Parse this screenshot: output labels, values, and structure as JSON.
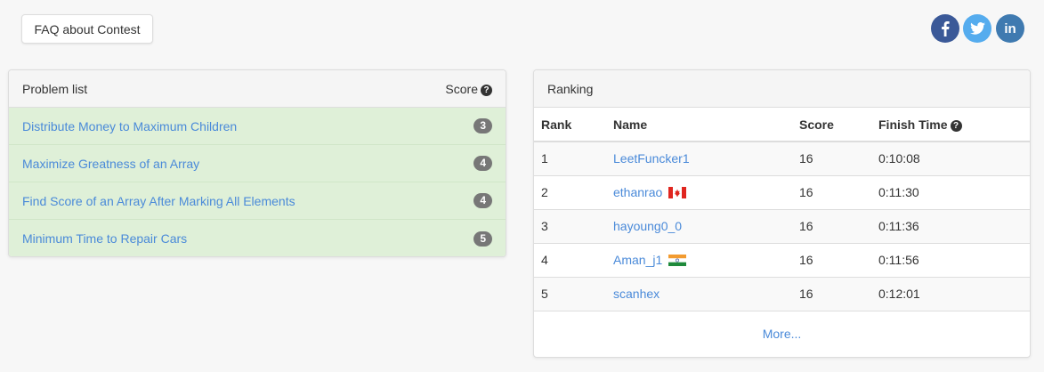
{
  "faq_button": "FAQ about Contest",
  "social": [
    {
      "name": "facebook",
      "glyph": "f",
      "color": "#3b5998"
    },
    {
      "name": "twitter",
      "glyph": "t",
      "color": "#55acee"
    },
    {
      "name": "linkedin",
      "glyph": "in",
      "color": "#3f7ab0"
    }
  ],
  "problems": {
    "title": "Problem list",
    "score_label": "Score",
    "items": [
      {
        "name": "Distribute Money to Maximum Children",
        "score": "3"
      },
      {
        "name": "Maximize Greatness of an Array",
        "score": "4"
      },
      {
        "name": "Find Score of an Array After Marking All Elements",
        "score": "4"
      },
      {
        "name": "Minimum Time to Repair Cars",
        "score": "5"
      }
    ]
  },
  "ranking": {
    "title": "Ranking",
    "columns": {
      "rank": "Rank",
      "name": "Name",
      "score": "Score",
      "finish": "Finish Time"
    },
    "rows": [
      {
        "rank": "1",
        "name": "LeetFuncker1",
        "score": "16",
        "finish": "0:10:08",
        "flag": ""
      },
      {
        "rank": "2",
        "name": "ethanrao",
        "score": "16",
        "finish": "0:11:30",
        "flag": "canada-flag"
      },
      {
        "rank": "3",
        "name": "hayoung0_0",
        "score": "16",
        "finish": "0:11:36",
        "flag": ""
      },
      {
        "rank": "4",
        "name": "Aman_j1",
        "score": "16",
        "finish": "0:11:56",
        "flag": "india-flag"
      },
      {
        "rank": "5",
        "name": "scanhex",
        "score": "16",
        "finish": "0:12:01",
        "flag": ""
      }
    ],
    "more": "More..."
  }
}
